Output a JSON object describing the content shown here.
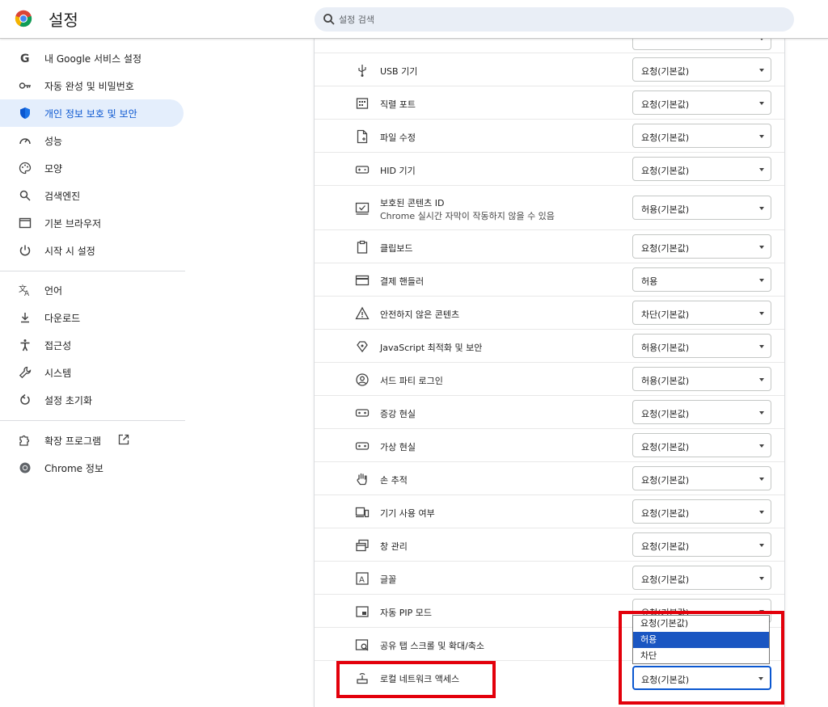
{
  "header": {
    "title": "설정",
    "search_placeholder": "설정 검색",
    "brand_colors": [
      "#db4437",
      "#f4b400",
      "#0f9d58",
      "#4285f4"
    ]
  },
  "sidebar": {
    "items": [
      {
        "label": "내 Google 서비스 설정",
        "icon": "google-g-icon"
      },
      {
        "label": "자동 완성 및 비밀번호",
        "icon": "key-icon"
      },
      {
        "label": "개인 정보 보호 및 보안",
        "icon": "shield-icon",
        "active": true
      },
      {
        "label": "성능",
        "icon": "speedometer-icon"
      },
      {
        "label": "모양",
        "icon": "palette-icon"
      },
      {
        "label": "검색엔진",
        "icon": "search-icon"
      },
      {
        "label": "기본 브라우저",
        "icon": "browser-window-icon"
      },
      {
        "label": "시작 시 설정",
        "icon": "power-icon"
      },
      {
        "label": "언어",
        "icon": "translate-icon"
      },
      {
        "label": "다운로드",
        "icon": "download-icon"
      },
      {
        "label": "접근성",
        "icon": "accessibility-icon"
      },
      {
        "label": "시스템",
        "icon": "wrench-icon"
      },
      {
        "label": "설정 초기화",
        "icon": "reset-icon"
      },
      {
        "label": "확장 프로그램",
        "icon": "puzzle-icon"
      },
      {
        "label": "Chrome 정보",
        "icon": "chrome-icon"
      }
    ],
    "active_color": "#0b57d0"
  },
  "permissions": [
    {
      "label": "USB 기기",
      "value": "요청(기본값)",
      "icon": "usb-icon"
    },
    {
      "label": "직렬 포트",
      "value": "요청(기본값)",
      "icon": "serial-port-icon"
    },
    {
      "label": "파일 수정",
      "value": "요청(기본값)",
      "icon": "file-edit-icon"
    },
    {
      "label": "HID 기기",
      "value": "요청(기본값)",
      "icon": "gamepad-icon"
    },
    {
      "label": "보호된 콘텐츠 ID",
      "sub": "Chrome 실시간 자막이 작동하지 않을 수 있음",
      "value": "허용(기본값)",
      "icon": "protected-content-icon"
    },
    {
      "label": "클립보드",
      "value": "요청(기본값)",
      "icon": "clipboard-icon"
    },
    {
      "label": "결제 핸들러",
      "value": "허용",
      "icon": "credit-card-icon"
    },
    {
      "label": "안전하지 않은 콘텐츠",
      "value": "차단(기본값)",
      "icon": "warning-icon"
    },
    {
      "label": "JavaScript 최적화 및 보안",
      "value": "허용(기본값)",
      "icon": "javascript-shield-icon"
    },
    {
      "label": "서드 파티 로그인",
      "value": "허용(기본값)",
      "icon": "account-circle-icon"
    },
    {
      "label": "증강 현실",
      "value": "요청(기본값)",
      "icon": "ar-headset-icon"
    },
    {
      "label": "가상 현실",
      "value": "요청(기본값)",
      "icon": "vr-headset-icon"
    },
    {
      "label": "손 추적",
      "value": "요청(기본값)",
      "icon": "hand-icon"
    },
    {
      "label": "기기 사용 여부",
      "value": "요청(기본값)",
      "icon": "devices-icon"
    },
    {
      "label": "창 관리",
      "value": "요청(기본값)",
      "icon": "window-management-icon"
    },
    {
      "label": "글꼴",
      "value": "요청(기본값)",
      "icon": "font-icon"
    },
    {
      "label": "자동 PIP 모드",
      "value": "요청(기본값)",
      "icon": "picture-in-picture-icon"
    },
    {
      "label": "공유 탭 스크롤 및 확대/축소",
      "value": "",
      "icon": "shared-tab-zoom-icon"
    },
    {
      "label": "로컬 네트워크 액세스",
      "value": "요청(기본값)",
      "icon": "local-network-icon",
      "focused": true
    }
  ],
  "dropdown": {
    "options": [
      "요청(기본값)",
      "허용",
      "차단"
    ],
    "highlighted_index": 1,
    "highlight_color": "#1a56c2"
  },
  "highlight_color": "#e3000b"
}
